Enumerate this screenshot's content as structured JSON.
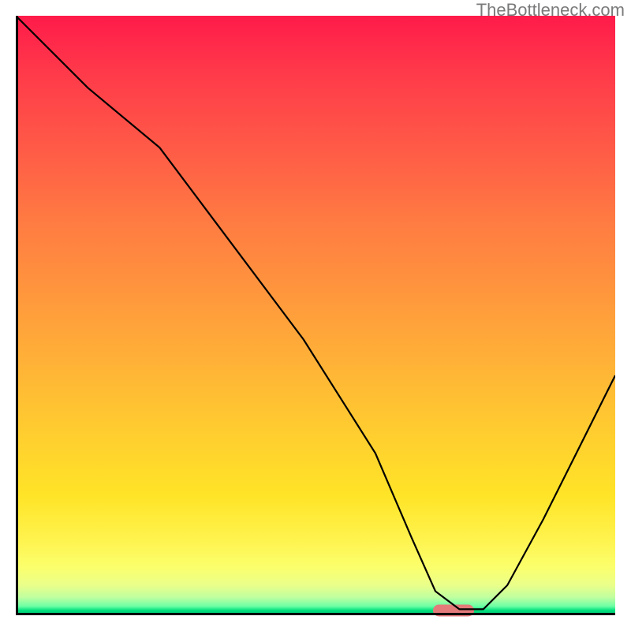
{
  "watermark": "TheBottleneck.com",
  "marker": {
    "x_pct": 73,
    "y_pct": 100
  },
  "chart_data": {
    "type": "line",
    "title": "",
    "xlabel": "",
    "ylabel": "",
    "xlim": [
      0,
      100
    ],
    "ylim": [
      0,
      100
    ],
    "grid": false,
    "legend": false,
    "series": [
      {
        "name": "bottleneck-curve",
        "x": [
          0,
          12,
          24,
          36,
          48,
          60,
          66,
          70,
          74,
          78,
          82,
          88,
          94,
          100
        ],
        "y": [
          100,
          88,
          78,
          62,
          46,
          27,
          13,
          4,
          1,
          1,
          5,
          16,
          28,
          40
        ]
      }
    ],
    "marker_segment": {
      "name": "highlight",
      "x_start": 70,
      "x_end": 77,
      "y": 0
    },
    "colors": {
      "gradient_top": "#ff1b4a",
      "gradient_mid": "#ffce2f",
      "gradient_bottom": "#00c070",
      "curve": "#000000",
      "marker": "#e47a7a",
      "axes": "#000000",
      "watermark": "#7a7a7a"
    }
  }
}
